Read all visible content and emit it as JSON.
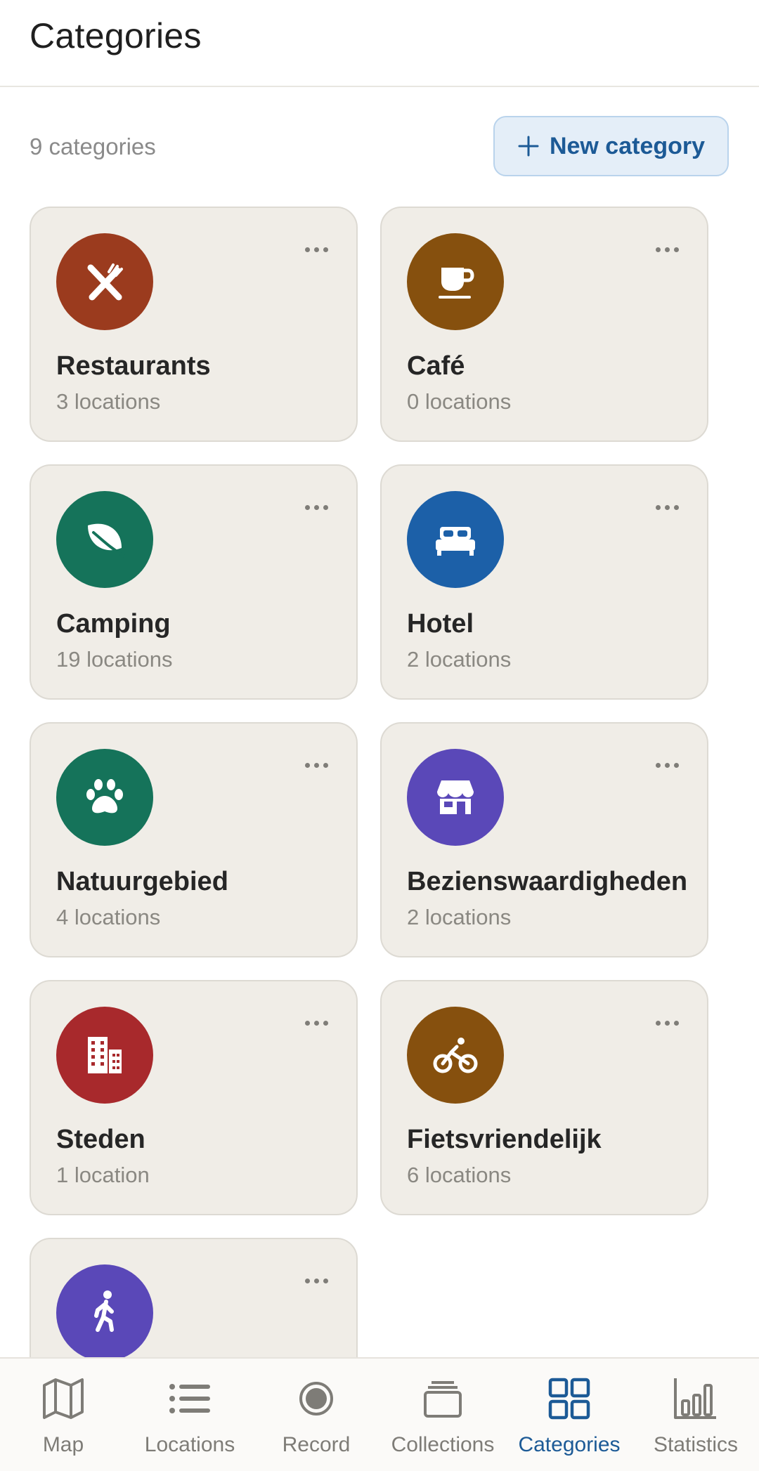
{
  "header": {
    "title": "Categories"
  },
  "toolbar": {
    "count": "9 categories",
    "new_label": "New category"
  },
  "categories": [
    {
      "name": "Restaurants",
      "count": "3 locations",
      "icon": "fork-knife-icon",
      "color": "#9b3b1e"
    },
    {
      "name": "Café",
      "count": "0 locations",
      "icon": "coffee-cup-icon",
      "color": "#86500e"
    },
    {
      "name": "Camping",
      "count": "19 locations",
      "icon": "leaf-icon",
      "color": "#15735a"
    },
    {
      "name": "Hotel",
      "count": "2 locations",
      "icon": "bed-icon",
      "color": "#1c60a8"
    },
    {
      "name": "Natuurgebied",
      "count": "4 locations",
      "icon": "paw-icon",
      "color": "#15735a"
    },
    {
      "name": "Bezienswaardigheden",
      "count": "2 locations",
      "icon": "storefront-icon",
      "color": "#5a48b8"
    },
    {
      "name": "Steden",
      "count": "1 location",
      "icon": "city-buildings-icon",
      "color": "#a8292c"
    },
    {
      "name": "Fietsvriendelijk",
      "count": "6 locations",
      "icon": "bicycle-icon",
      "color": "#86500e"
    },
    {
      "name": "",
      "count": "",
      "icon": "walking-person-icon",
      "color": "#5a48b8"
    }
  ],
  "nav": {
    "items": [
      {
        "label": "Map",
        "icon": "map-icon"
      },
      {
        "label": "Locations",
        "icon": "list-icon"
      },
      {
        "label": "Record",
        "icon": "record-icon"
      },
      {
        "label": "Collections",
        "icon": "collections-icon"
      },
      {
        "label": "Categories",
        "icon": "grid-icon"
      },
      {
        "label": "Statistics",
        "icon": "bar-chart-icon"
      }
    ],
    "active": "Categories"
  },
  "colors": {
    "accent": "#1c5a96",
    "card_bg": "#f0ede7",
    "muted_text": "#8a8882"
  }
}
